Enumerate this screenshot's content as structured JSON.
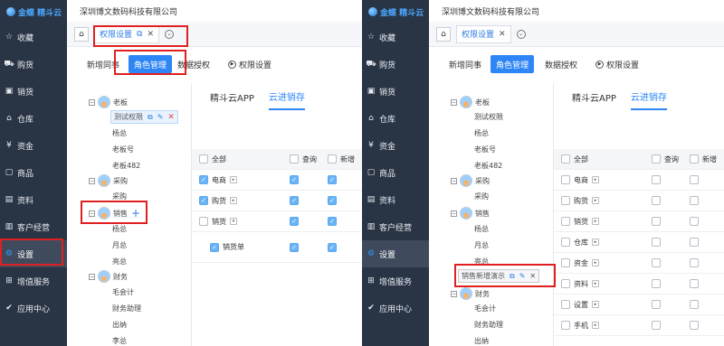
{
  "brand": {
    "logo_text": "金蝶 精斗云"
  },
  "company": "深圳博文数码科技有限公司",
  "nav": [
    {
      "icon": "star-icon",
      "label": "收藏"
    },
    {
      "icon": "cart-icon",
      "label": "购货"
    },
    {
      "icon": "sales-icon",
      "label": "销货"
    },
    {
      "icon": "home-icon",
      "label": "仓库"
    },
    {
      "icon": "coin-icon",
      "label": "资金"
    },
    {
      "icon": "box-icon",
      "label": "商品"
    },
    {
      "icon": "document-icon",
      "label": "资料"
    },
    {
      "icon": "customer-icon",
      "label": "客户经营"
    },
    {
      "icon": "gear-icon",
      "label": "设置"
    },
    {
      "icon": "valueadd-icon",
      "label": "增值服务"
    },
    {
      "icon": "check-icon",
      "label": "应用中心"
    }
  ],
  "page_tab": {
    "label": "权限设置"
  },
  "subtabs": [
    "新增同事",
    "角色管理",
    "数据授权",
    "权限设置"
  ],
  "right_tabs": [
    "精斗云APP",
    "云进销存"
  ],
  "grid": {
    "all": "全部",
    "query": "查询",
    "add": "新增"
  },
  "left": {
    "tree": [
      "老板",
      "测试权限",
      "杨总",
      "老板号",
      "老板482",
      "采购",
      "采购",
      "销售",
      "杨总",
      "月总",
      "亮总",
      "财务",
      "毛会计",
      "财务助理",
      "出纳",
      "李总"
    ],
    "rows": [
      {
        "label": "电商",
        "checked": true,
        "query": true,
        "add": true
      },
      {
        "label": "购货",
        "checked": true,
        "query": true,
        "add": true
      },
      {
        "label": "销货",
        "checked": false,
        "query": true,
        "add": true
      },
      {
        "label": "销货单",
        "checked": true,
        "query": true,
        "add": true
      }
    ]
  },
  "right": {
    "tree": [
      "老板",
      "测试权限",
      "杨总",
      "老板号",
      "老板482",
      "采购",
      "采购",
      "销售",
      "杨总",
      "月总",
      "亮总",
      "销售新增演示",
      "财务",
      "毛会计",
      "财务助理",
      "出纳"
    ],
    "rows": [
      "电商",
      "购货",
      "销货",
      "仓库",
      "资金",
      "资料",
      "设置",
      "手机"
    ]
  }
}
